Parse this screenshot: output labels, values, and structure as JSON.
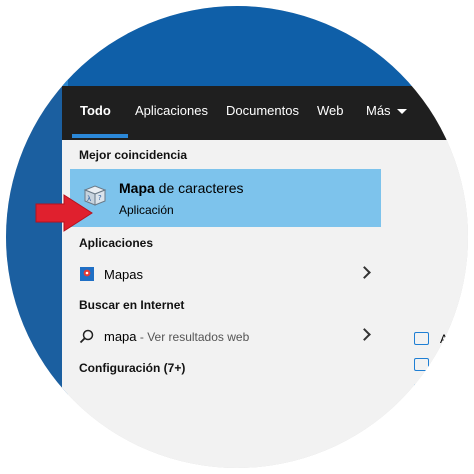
{
  "nav": {
    "tabs": [
      {
        "label": "Todo",
        "active": true
      },
      {
        "label": "Aplicaciones"
      },
      {
        "label": "Documentos"
      },
      {
        "label": "Web"
      },
      {
        "label": "Más"
      }
    ]
  },
  "sections": {
    "best_match": "Mejor coincidencia",
    "apps": "Aplicaciones",
    "internet": "Buscar en Internet",
    "settings": "Configuración (7+)"
  },
  "best_match": {
    "title_bold": "Mapa",
    "title_rest": " de caracteres",
    "subtitle": "Aplicación",
    "icon": "character-map-icon"
  },
  "apps": [
    {
      "label": "Mapas",
      "icon": "maps-icon"
    }
  ],
  "internet": {
    "query": "mapa",
    "hint": " - Ver resultados web",
    "icon": "search-icon"
  },
  "side_actions": [
    {
      "text": "Ab"
    }
  ],
  "colors": {
    "accent": "#2b88d8",
    "highlight": "#7dc3ec",
    "nav_bg": "#1f1f1f",
    "arrow": "#e0202e"
  }
}
